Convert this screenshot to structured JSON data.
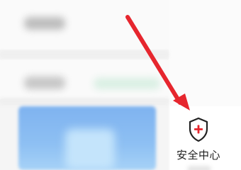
{
  "security_center": {
    "label": "安全中心",
    "icon": "shield-plus-icon"
  },
  "annotation": {
    "arrow_color": "#e6262e"
  },
  "colors": {
    "accent_red": "#e6262e",
    "blue_tile": "#8ec0f3"
  }
}
